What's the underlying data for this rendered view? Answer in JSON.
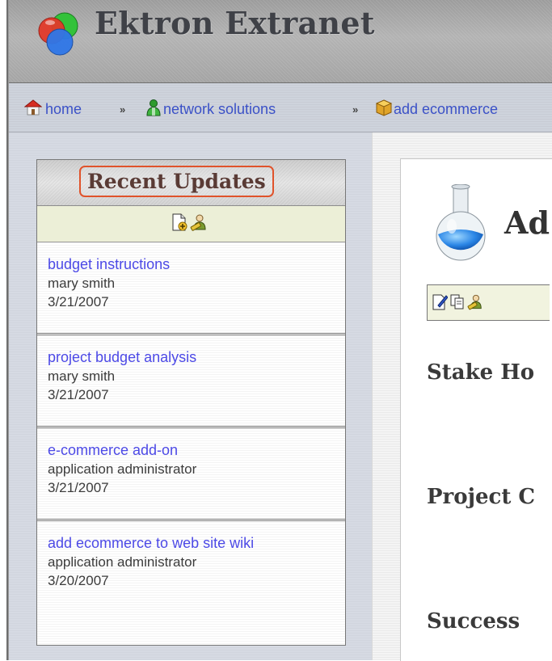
{
  "header": {
    "site_title": "Ektron Extranet",
    "logo_icon": "ektron-logo-icon"
  },
  "breadcrumb": {
    "separator": "»",
    "items": [
      {
        "label": "home",
        "icon": "house-icon"
      },
      {
        "label": "network solutions",
        "icon": "user-icon"
      },
      {
        "label": "add ecommerce",
        "icon": "package-icon"
      }
    ]
  },
  "recent_updates": {
    "title": "Recent Updates",
    "tools": [
      {
        "icon": "add-document-icon"
      },
      {
        "icon": "edit-permissions-icon"
      }
    ],
    "items": [
      {
        "title": "budget instructions",
        "author": "mary smith",
        "date": "3/21/2007"
      },
      {
        "title": "project budget analysis",
        "author": "mary smith",
        "date": "3/21/2007"
      },
      {
        "title": "e-commerce add-on",
        "author": "application administrator",
        "date": "3/21/2007"
      },
      {
        "title": "add ecommerce to web site wiki",
        "author": "application administrator",
        "date": "3/20/2007"
      }
    ]
  },
  "content": {
    "page_icon": "flask-icon",
    "title": "Ad",
    "tools": [
      {
        "icon": "edit-icon"
      },
      {
        "icon": "copy-icon"
      },
      {
        "icon": "permissions-icon"
      }
    ],
    "sections": [
      "Stake Ho",
      "Project C",
      "Success"
    ]
  },
  "colors": {
    "link": "#4c49e6",
    "breadcrumb_link": "#3b51c7",
    "highlight_border": "#e0532b"
  }
}
